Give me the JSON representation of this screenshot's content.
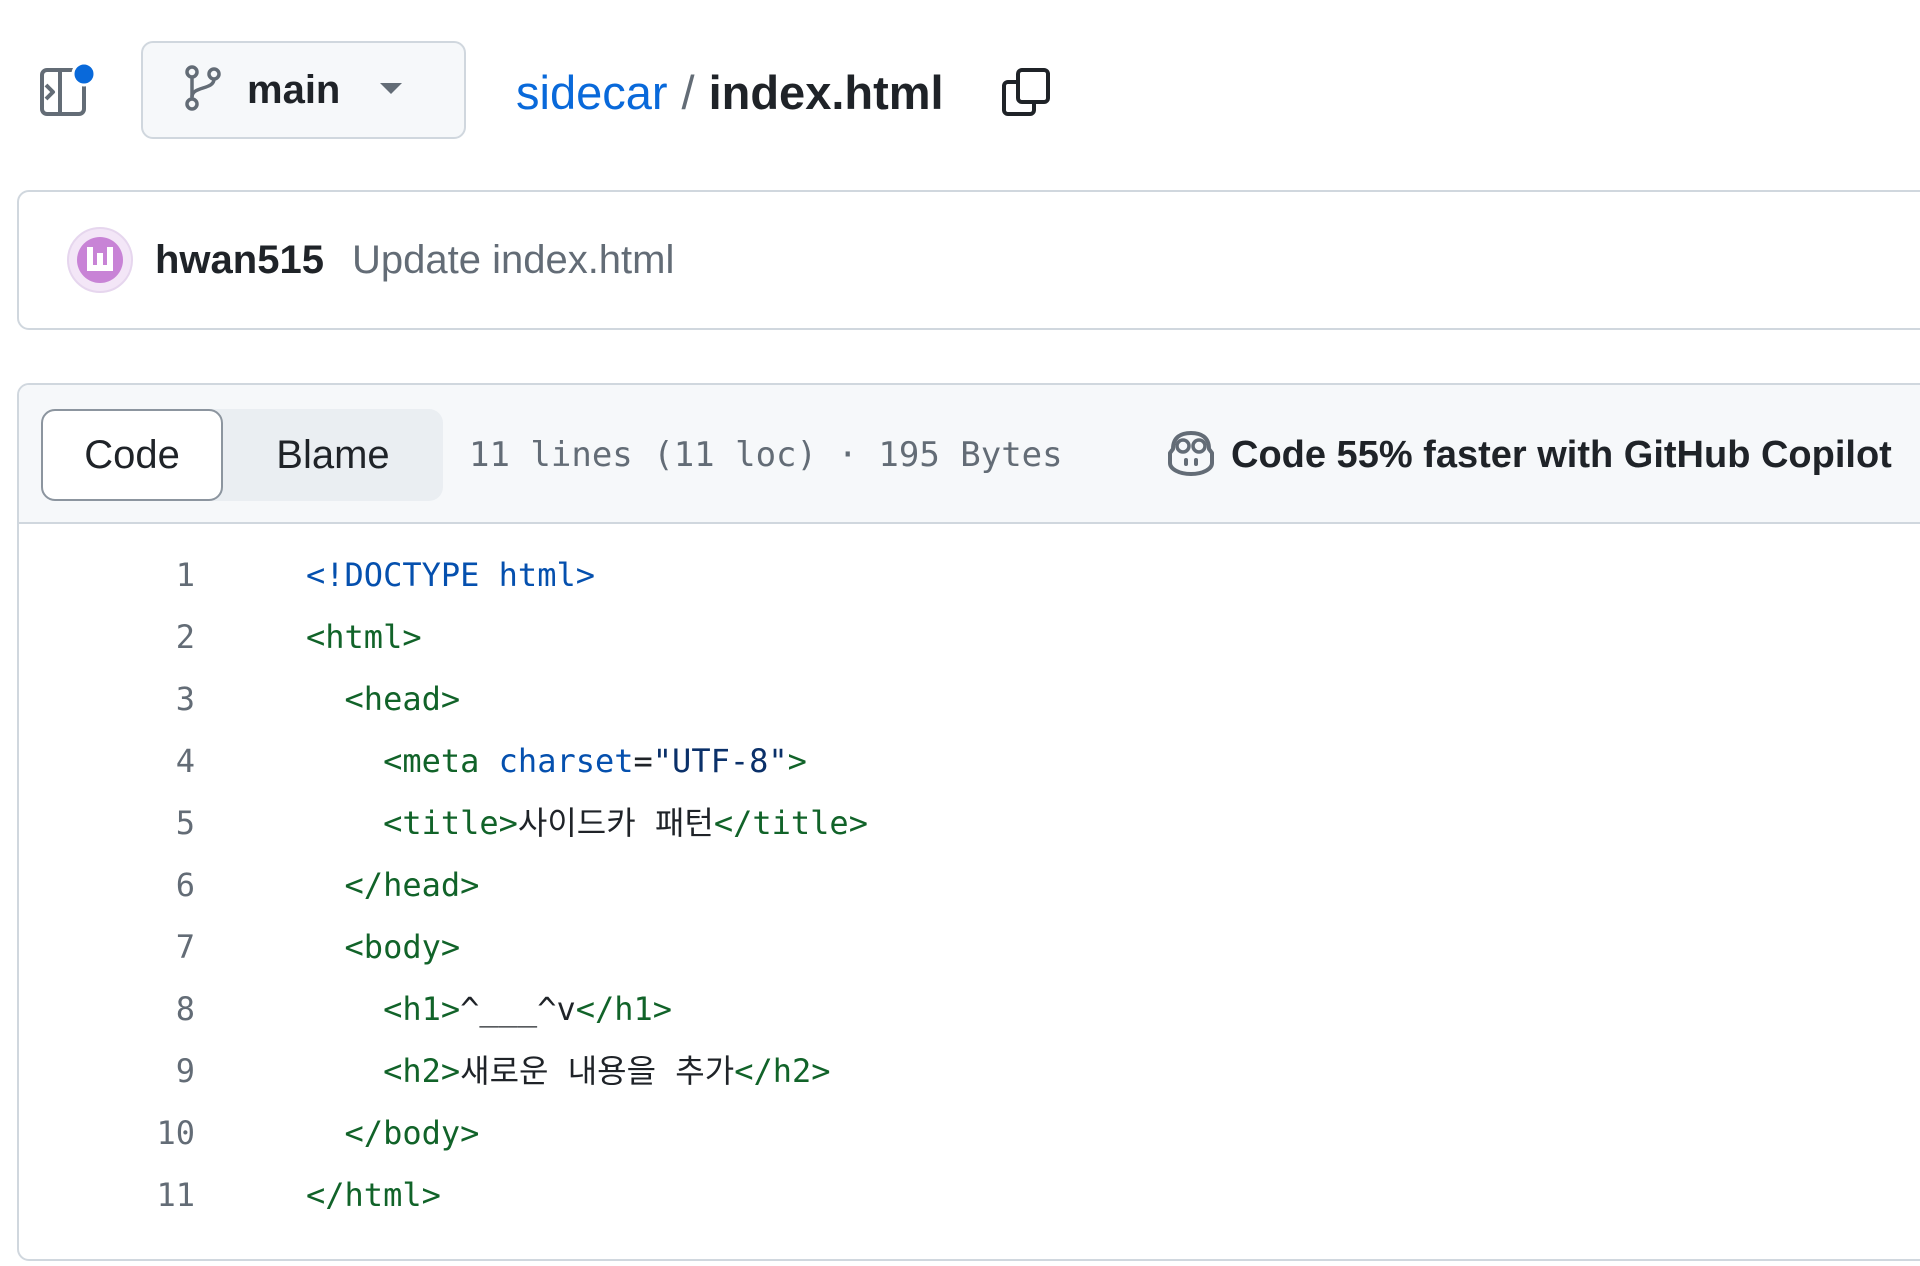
{
  "header": {
    "branch": "main",
    "repo": "sidecar",
    "separator": "/",
    "file": "index.html"
  },
  "commit": {
    "author": "hwan515",
    "message": "Update index.html"
  },
  "toolbar": {
    "code_tab": "Code",
    "blame_tab": "Blame",
    "file_info": "11 lines (11 loc) · 195 Bytes",
    "copilot": "Code 55% faster with GitHub Copilot"
  },
  "code": {
    "lines": [
      {
        "n": "1",
        "indent": "",
        "tokens": [
          {
            "t": "<!DOCTYPE html>",
            "c": "tok-doc"
          }
        ]
      },
      {
        "n": "2",
        "indent": "",
        "tokens": [
          {
            "t": "<html>",
            "c": "tok-tag"
          }
        ]
      },
      {
        "n": "3",
        "indent": "  ",
        "tokens": [
          {
            "t": "<head>",
            "c": "tok-tag"
          }
        ]
      },
      {
        "n": "4",
        "indent": "    ",
        "tokens": [
          {
            "t": "<meta ",
            "c": "tok-tag"
          },
          {
            "t": "charset",
            "c": "tok-attr"
          },
          {
            "t": "=",
            "c": "tok-txt"
          },
          {
            "t": "\"UTF-8\"",
            "c": "tok-str"
          },
          {
            "t": ">",
            "c": "tok-tag"
          }
        ]
      },
      {
        "n": "5",
        "indent": "    ",
        "tokens": [
          {
            "t": "<title>",
            "c": "tok-tag"
          },
          {
            "t": "사이드카 패턴",
            "c": "tok-txt"
          },
          {
            "t": "</title>",
            "c": "tok-tag"
          }
        ]
      },
      {
        "n": "6",
        "indent": "  ",
        "tokens": [
          {
            "t": "</head>",
            "c": "tok-tag"
          }
        ]
      },
      {
        "n": "7",
        "indent": "  ",
        "tokens": [
          {
            "t": "<body>",
            "c": "tok-tag"
          }
        ]
      },
      {
        "n": "8",
        "indent": "    ",
        "tokens": [
          {
            "t": "<h1>",
            "c": "tok-tag"
          },
          {
            "t": "^___^v",
            "c": "tok-txt"
          },
          {
            "t": "</h1>",
            "c": "tok-tag"
          }
        ]
      },
      {
        "n": "9",
        "indent": "    ",
        "tokens": [
          {
            "t": "<h2>",
            "c": "tok-tag"
          },
          {
            "t": "새로운 내용을 추가",
            "c": "tok-txt"
          },
          {
            "t": "</h2>",
            "c": "tok-tag"
          }
        ]
      },
      {
        "n": "10",
        "indent": "  ",
        "tokens": [
          {
            "t": "</body>",
            "c": "tok-tag"
          }
        ]
      },
      {
        "n": "11",
        "indent": "",
        "tokens": [
          {
            "t": "</html>",
            "c": "tok-tag"
          }
        ]
      }
    ]
  },
  "icons": {
    "sidebar": "sidebar-expand-icon",
    "branch": "git-branch-icon",
    "caret": "triangle-down-icon",
    "copy": "copy-icon",
    "copilot": "copilot-icon"
  },
  "colors": {
    "link": "#0969da",
    "notification_dot": "#0969da",
    "avatar": "#c883d6"
  }
}
